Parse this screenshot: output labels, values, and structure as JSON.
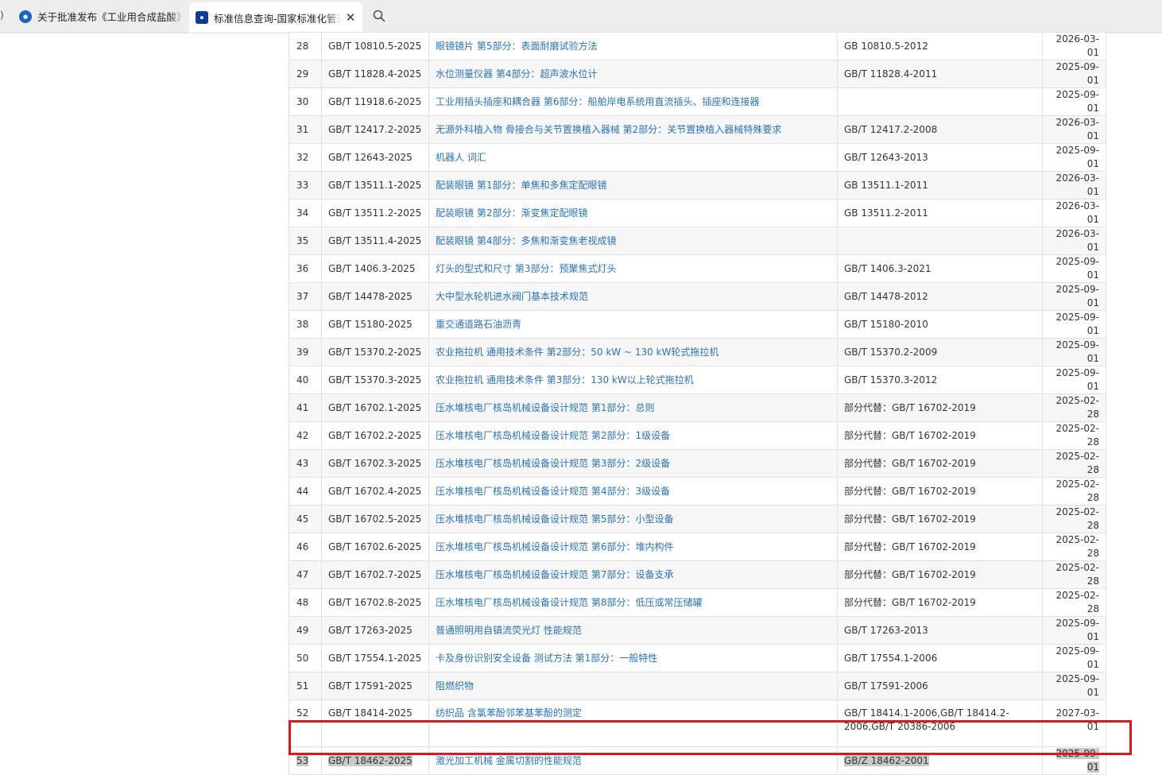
{
  "tabs": [
    {
      "title": "关于批准发布《工业用合成盐酸》等",
      "icon": "agency-logo-icon"
    },
    {
      "title": "标准信息查询-国家标准化管理委员会",
      "icon": "sac-logo-icon",
      "active": true,
      "close_glyph": "✕"
    }
  ],
  "tab_edge_glyph": ")",
  "highlight_color": "#e0161c",
  "link_color": "#2a72b5",
  "rows": [
    {
      "num": "28",
      "code": "GB/T 10810.5-2025",
      "name": "眼镜镜片 第5部分：表面耐磨试验方法",
      "replaces": "GB 10810.5-2012",
      "date": "2026-03-01"
    },
    {
      "num": "29",
      "code": "GB/T 11828.4-2025",
      "name": "水位测量仪器 第4部分：超声波水位计",
      "replaces": "GB/T 11828.4-2011",
      "date": "2025-09-01"
    },
    {
      "num": "30",
      "code": "GB/T 11918.6-2025",
      "name": "工业用插头插座和耦合器 第6部分：船舶岸电系统用直流插头、插座和连接器",
      "replaces": "",
      "date": "2025-09-01"
    },
    {
      "num": "31",
      "code": "GB/T 12417.2-2025",
      "name": "无源外科植入物 骨接合与关节置换植入器械 第2部分：关节置换植入器械特殊要求",
      "replaces": "GB/T 12417.2-2008",
      "date": "2026-03-01"
    },
    {
      "num": "32",
      "code": "GB/T 12643-2025",
      "name": "机器人 词汇",
      "replaces": "GB/T 12643-2013",
      "date": "2025-09-01"
    },
    {
      "num": "33",
      "code": "GB/T 13511.1-2025",
      "name": "配装眼镜 第1部分：单焦和多焦定配眼镜",
      "replaces": "GB 13511.1-2011",
      "date": "2026-03-01"
    },
    {
      "num": "34",
      "code": "GB/T 13511.2-2025",
      "name": "配装眼镜 第2部分：渐变焦定配眼镜",
      "replaces": "GB 13511.2-2011",
      "date": "2026-03-01"
    },
    {
      "num": "35",
      "code": "GB/T 13511.4-2025",
      "name": "配装眼镜 第4部分：多焦和渐变焦老视成镜",
      "replaces": "",
      "date": "2026-03-01"
    },
    {
      "num": "36",
      "code": "GB/T 1406.3-2025",
      "name": "灯头的型式和尺寸 第3部分：预聚焦式灯头",
      "replaces": "GB/T 1406.3-2021",
      "date": "2025-09-01"
    },
    {
      "num": "37",
      "code": "GB/T 14478-2025",
      "name": "大中型水轮机进水阀门基本技术规范",
      "replaces": "GB/T 14478-2012",
      "date": "2025-09-01"
    },
    {
      "num": "38",
      "code": "GB/T 15180-2025",
      "name": "重交通道路石油沥青",
      "replaces": "GB/T 15180-2010",
      "date": "2025-09-01"
    },
    {
      "num": "39",
      "code": "GB/T 15370.2-2025",
      "name": "农业拖拉机 通用技术条件 第2部分：50 kW ~ 130 kW轮式拖拉机",
      "replaces": "GB/T 15370.2-2009",
      "date": "2025-09-01"
    },
    {
      "num": "40",
      "code": "GB/T 15370.3-2025",
      "name": "农业拖拉机 通用技术条件 第3部分：130 kW以上轮式拖拉机",
      "replaces": "GB/T 15370.3-2012",
      "date": "2025-09-01"
    },
    {
      "num": "41",
      "code": "GB/T 16702.1-2025",
      "name": "压水堆核电厂核岛机械设备设计规范 第1部分：总则",
      "replaces": "部分代替：GB/T 16702-2019",
      "date": "2025-02-28"
    },
    {
      "num": "42",
      "code": "GB/T 16702.2-2025",
      "name": "压水堆核电厂核岛机械设备设计规范 第2部分：1级设备",
      "replaces": "部分代替：GB/T 16702-2019",
      "date": "2025-02-28"
    },
    {
      "num": "43",
      "code": "GB/T 16702.3-2025",
      "name": "压水堆核电厂核岛机械设备设计规范 第3部分：2级设备",
      "replaces": "部分代替：GB/T 16702-2019",
      "date": "2025-02-28"
    },
    {
      "num": "44",
      "code": "GB/T 16702.4-2025",
      "name": "压水堆核电厂核岛机械设备设计规范 第4部分：3级设备",
      "replaces": "部分代替：GB/T 16702-2019",
      "date": "2025-02-28"
    },
    {
      "num": "45",
      "code": "GB/T 16702.5-2025",
      "name": "压水堆核电厂核岛机械设备设计规范 第5部分：小型设备",
      "replaces": "部分代替：GB/T 16702-2019",
      "date": "2025-02-28"
    },
    {
      "num": "46",
      "code": "GB/T 16702.6-2025",
      "name": "压水堆核电厂核岛机械设备设计规范 第6部分：堆内构件",
      "replaces": "部分代替：GB/T 16702-2019",
      "date": "2025-02-28"
    },
    {
      "num": "47",
      "code": "GB/T 16702.7-2025",
      "name": "压水堆核电厂核岛机械设备设计规范 第7部分：设备支承",
      "replaces": "部分代替：GB/T 16702-2019",
      "date": "2025-02-28"
    },
    {
      "num": "48",
      "code": "GB/T 16702.8-2025",
      "name": "压水堆核电厂核岛机械设备设计规范 第8部分：低压或常压储罐",
      "replaces": "部分代替：GB/T 16702-2019",
      "date": "2025-02-28"
    },
    {
      "num": "49",
      "code": "GB/T 17263-2025",
      "name": "普通照明用自镇流荧光灯 性能规范",
      "replaces": "GB/T 17263-2013",
      "date": "2025-09-01"
    },
    {
      "num": "50",
      "code": "GB/T 17554.1-2025",
      "name": "卡及身份识别安全设备 测试方法 第1部分：一般特性",
      "replaces": "GB/T 17554.1-2006",
      "date": "2025-09-01"
    },
    {
      "num": "51",
      "code": "GB/T 17591-2025",
      "name": "阻燃织物",
      "replaces": "GB/T 17591-2006",
      "date": "2025-09-01"
    },
    {
      "num": "52",
      "code": "GB/T 18414-2025",
      "name": "纺织品 含氯苯酚邻苯基苯酚的测定",
      "replaces": "GB/T 18414.1-2006,GB/T 18414.2-2006,GB/T 20386-2006",
      "date": "2027-03-01"
    },
    {
      "num": "53",
      "code": "GB/T 18462-2025",
      "name": "激光加工机械 金属切割的性能规范",
      "replaces": "GB/Z 18462-2001",
      "date": "2025-09-01",
      "selected": true
    }
  ]
}
